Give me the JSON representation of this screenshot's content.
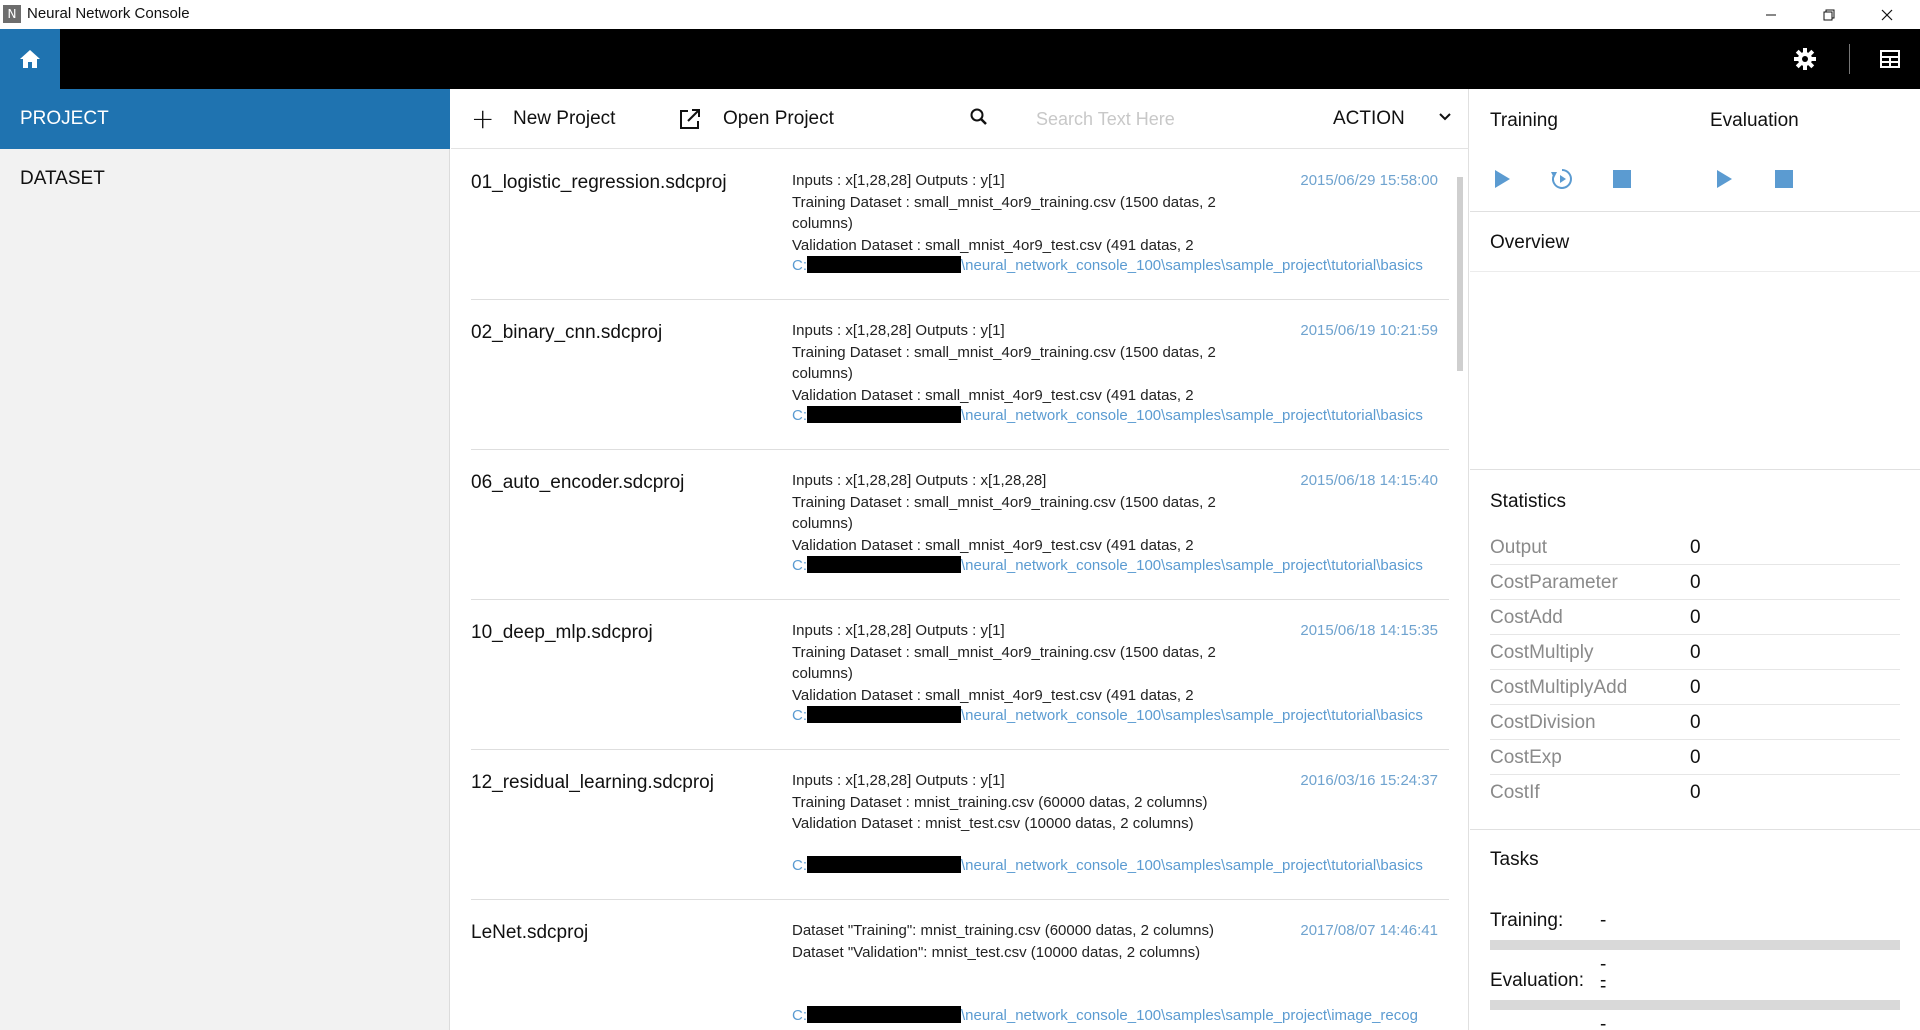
{
  "window": {
    "title": "Neural Network Console",
    "icon_letter": "N"
  },
  "nav": {
    "project": "PROJECT",
    "dataset": "DATASET"
  },
  "toolbar": {
    "new_project": "New Project",
    "open_project": "Open Project",
    "search_placeholder": "Search Text Here",
    "action": "ACTION"
  },
  "projects": [
    {
      "name": "01_logistic_regression.sdcproj",
      "lines": [
        "Inputs : x[1,28,28]    Outputs : y[1]",
        "Training Dataset : small_mnist_4or9_training.csv    (1500 datas, 2",
        "columns)",
        "Validation Dataset : small_mnist_4or9_test.csv    (491 datas, 2"
      ],
      "date": "2015/06/29 15:58:00",
      "path_prefix": "C:",
      "path_suffix": "\\neural_network_console_100\\samples\\sample_project\\tutorial\\basics"
    },
    {
      "name": "02_binary_cnn.sdcproj",
      "lines": [
        "Inputs : x[1,28,28]    Outputs : y[1]",
        "Training Dataset : small_mnist_4or9_training.csv    (1500 datas, 2",
        "columns)",
        "Validation Dataset : small_mnist_4or9_test.csv    (491 datas, 2"
      ],
      "date": "2015/06/19 10:21:59",
      "path_prefix": "C:",
      "path_suffix": "\\neural_network_console_100\\samples\\sample_project\\tutorial\\basics"
    },
    {
      "name": "06_auto_encoder.sdcproj",
      "lines": [
        "Inputs : x[1,28,28]    Outputs : x[1,28,28]",
        "Training Dataset : small_mnist_4or9_training.csv    (1500 datas, 2",
        "columns)",
        "Validation Dataset : small_mnist_4or9_test.csv    (491 datas, 2"
      ],
      "date": "2015/06/18 14:15:40",
      "path_prefix": "C:",
      "path_suffix": "\\neural_network_console_100\\samples\\sample_project\\tutorial\\basics"
    },
    {
      "name": "10_deep_mlp.sdcproj",
      "lines": [
        "Inputs : x[1,28,28]    Outputs : y[1]",
        "Training Dataset : small_mnist_4or9_training.csv    (1500 datas, 2",
        "columns)",
        "Validation Dataset : small_mnist_4or9_test.csv    (491 datas, 2"
      ],
      "date": "2015/06/18 14:15:35",
      "path_prefix": "C:",
      "path_suffix": "\\neural_network_console_100\\samples\\sample_project\\tutorial\\basics"
    },
    {
      "name": "12_residual_learning.sdcproj",
      "lines": [
        "Inputs : x[1,28,28]    Outputs : y[1]",
        "Training Dataset : mnist_training.csv    (60000 datas, 2 columns)",
        "Validation Dataset : mnist_test.csv    (10000 datas, 2 columns)",
        ""
      ],
      "date": "2016/03/16 15:24:37",
      "path_prefix": "C:",
      "path_suffix": "\\neural_network_console_100\\samples\\sample_project\\tutorial\\basics"
    },
    {
      "name": "LeNet.sdcproj",
      "lines": [
        "Dataset \"Training\": mnist_training.csv    (60000 datas, 2 columns)",
        "Dataset \"Validation\": mnist_test.csv    (10000 datas, 2 columns)",
        "",
        ""
      ],
      "date": "2017/08/07 14:46:41",
      "path_prefix": "C:",
      "path_suffix": "\\neural_network_console_100\\samples\\sample_project\\image_recog"
    }
  ],
  "right": {
    "training": "Training",
    "evaluation": "Evaluation",
    "overview": "Overview",
    "statistics": "Statistics",
    "stats": [
      {
        "name": "Output",
        "value": "0"
      },
      {
        "name": "CostParameter",
        "value": "0"
      },
      {
        "name": "CostAdd",
        "value": "0"
      },
      {
        "name": "CostMultiply",
        "value": "0"
      },
      {
        "name": "CostMultiplyAdd",
        "value": "0"
      },
      {
        "name": "CostDivision",
        "value": "0"
      },
      {
        "name": "CostExp",
        "value": "0"
      },
      {
        "name": "CostIf",
        "value": "0"
      }
    ],
    "tasks": "Tasks",
    "task_training_label": "Training:",
    "task_training_value": "----",
    "task_evaluation_label": "Evaluation:",
    "task_evaluation_value": "----"
  },
  "colors": {
    "accent": "#1f73b0",
    "control_blue": "#5b9bd1",
    "date_text": "#6fa3cf"
  },
  "icons": {
    "home": "home-icon",
    "settings": "gear-icon",
    "layout": "layout-icon",
    "new": "plus-icon",
    "open": "open-external-icon",
    "search": "search-icon",
    "dropdown": "chevron-down-icon",
    "play": "play-icon",
    "resume": "resume-icon",
    "stop": "stop-icon"
  }
}
